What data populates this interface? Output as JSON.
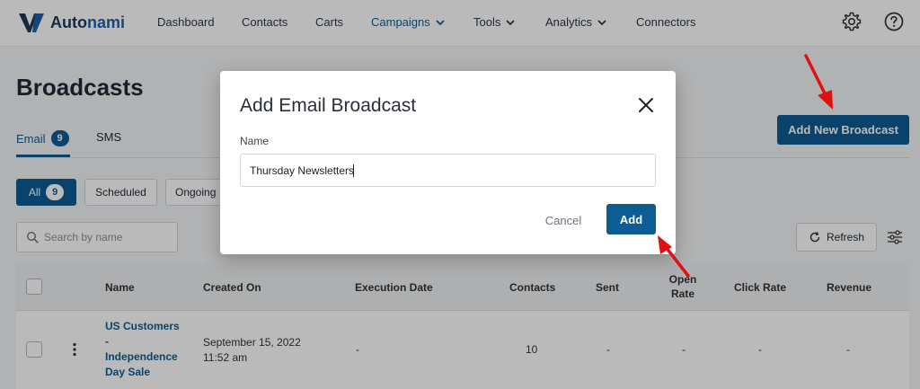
{
  "app": {
    "brand": "Autonami",
    "brand_prefix": "Auto",
    "brand_suffix": "nami"
  },
  "nav": {
    "items": [
      {
        "label": "Dashboard"
      },
      {
        "label": "Contacts"
      },
      {
        "label": "Carts"
      },
      {
        "label": "Campaigns"
      },
      {
        "label": "Tools"
      },
      {
        "label": "Analytics"
      },
      {
        "label": "Connectors"
      }
    ],
    "active": "Campaigns",
    "icons": [
      "gear-icon",
      "help-icon"
    ]
  },
  "page": {
    "title": "Broadcasts",
    "tabs": [
      {
        "label": "Email",
        "count": "9"
      },
      {
        "label": "SMS"
      }
    ],
    "add_new_label": "Add New Broadcast",
    "filters": [
      {
        "label": "All",
        "count": "9"
      },
      {
        "label": "Scheduled"
      },
      {
        "label": "Ongoing"
      }
    ],
    "search_placeholder": "Search by name",
    "refresh_label": "Refresh"
  },
  "table": {
    "columns": [
      "Name",
      "Created On",
      "Execution Date",
      "Contacts",
      "Sent",
      "Open Rate",
      "Click Rate",
      "Revenue"
    ],
    "rows": [
      {
        "name_lines": [
          "US Customers",
          "-",
          "Independence",
          "Day Sale"
        ],
        "created_on": [
          "September 15, 2022",
          "11:52 am"
        ],
        "execution_date": "-",
        "contacts": "10",
        "sent": "-",
        "open_rate": "-",
        "click_rate": "-",
        "revenue": "-"
      }
    ]
  },
  "modal": {
    "title": "Add Email Broadcast",
    "name_label": "Name",
    "name_value": "Thursday Newsletters",
    "cancel_label": "Cancel",
    "add_label": "Add"
  },
  "colors": {
    "primary": "#0d5d94",
    "annotation_arrow": "#e01010"
  }
}
